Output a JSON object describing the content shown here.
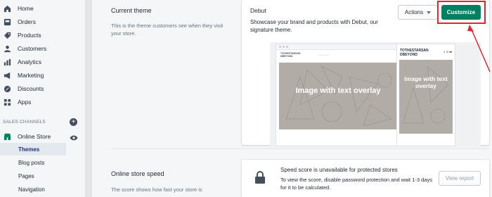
{
  "sidebar": {
    "items": [
      {
        "label": "Home",
        "icon": "home-icon"
      },
      {
        "label": "Orders",
        "icon": "orders-icon"
      },
      {
        "label": "Products",
        "icon": "products-icon"
      },
      {
        "label": "Customers",
        "icon": "customers-icon"
      },
      {
        "label": "Analytics",
        "icon": "analytics-icon"
      },
      {
        "label": "Marketing",
        "icon": "marketing-icon"
      },
      {
        "label": "Discounts",
        "icon": "discounts-icon"
      },
      {
        "label": "Apps",
        "icon": "apps-icon"
      }
    ],
    "section_label": "SALES CHANNELS",
    "online_store": "Online Store",
    "sub_items": [
      {
        "label": "Themes",
        "active": true
      },
      {
        "label": "Blog posts",
        "active": false
      },
      {
        "label": "Pages",
        "active": false
      },
      {
        "label": "Navigation",
        "active": false
      }
    ]
  },
  "current_theme": {
    "heading": "Current theme",
    "description": "This is the theme customers see when they visit your store.",
    "theme_name": "Debut",
    "theme_description": "Showcase your brand and products with Debut, our signature theme.",
    "actions_label": "Actions",
    "customize_label": "Customize",
    "preview": {
      "store_name": "TOTHESTARSAN DBEYOND",
      "hero_title": "Image with text overlay",
      "phone_store_name": "TOTHESTARSAN DBEYOND",
      "phone_hero_title": "Image with text overlay"
    }
  },
  "speed": {
    "heading": "Online store speed",
    "description": "The score shows how fast your store is",
    "title": "Speed score is unavailable for protected stores",
    "text": "To view the score, disable password protection and wait 1-3 days for it to be calculated.",
    "report_label": "View report"
  },
  "colors": {
    "primary": "#008060",
    "highlight": "#e3242b",
    "active_text": "#202e78"
  }
}
